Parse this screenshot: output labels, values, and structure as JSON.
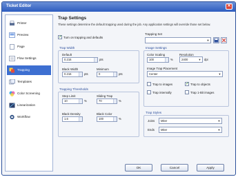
{
  "window": {
    "title": "Ticket Editor"
  },
  "sidebar": {
    "items": [
      {
        "label": "Printer",
        "icon": "printer-icon",
        "active": false
      },
      {
        "label": "Preview",
        "icon": "preview-icon",
        "active": false
      },
      {
        "label": "Page",
        "icon": "page-icon",
        "active": false
      },
      {
        "label": "Flow Settings",
        "icon": "flow-settings-icon",
        "active": false
      },
      {
        "label": "Trapping",
        "icon": "trapping-icon",
        "active": true
      },
      {
        "label": "Templates",
        "icon": "templates-icon",
        "active": false
      },
      {
        "label": "Color Screening",
        "icon": "color-screening-icon",
        "active": false
      },
      {
        "label": "Linearization",
        "icon": "linearization-icon",
        "active": false
      },
      {
        "label": "Workflow",
        "icon": "workflow-icon",
        "active": false
      }
    ]
  },
  "trap": {
    "title": "Trap Settings",
    "description": "These settings determine the default trapping used during the job. Any application settings will override those set below.",
    "turn_on_label": "Turn on trapping and defaults",
    "trapping_set_label": "Trapping Set",
    "trapping_set_value": "",
    "trap_width": {
      "title": "Trap Width",
      "default_label": "Default",
      "default_value": "0.216",
      "default_unit": "pts",
      "black_width_label": "Black Width",
      "black_width_value": "0.216",
      "black_width_unit": "pts",
      "minimum_label": "Minimum",
      "minimum_value": "0",
      "minimum_unit": "pts"
    },
    "thresholds": {
      "title": "Trapping Thresholds",
      "step_limit_label": "Step Limit",
      "step_limit_value": "10",
      "step_limit_unit": "%",
      "sliding_trap_label": "Sliding Trap",
      "sliding_trap_value": "70",
      "sliding_trap_unit": "%",
      "black_density_label": "Black Density",
      "black_density_value": "1.6",
      "black_color_label": "Black Color",
      "black_color_value": "100",
      "black_color_unit": "%"
    },
    "image_settings": {
      "title": "Image Settings",
      "color_scaling_label": "Color Scaling",
      "color_scaling_value": "100",
      "color_scaling_unit": "%",
      "resolution_label": "Resolution",
      "resolution_value": "2400",
      "resolution_unit": "dpi",
      "placement_label": "Image Trap Placement",
      "placement_value": "Center",
      "trap_to_images_label": "Trap to images",
      "trap_to_objects_label": "Trap to objects",
      "trap_internally_label": "Trap internally",
      "trap_1bit_label": "Trap 1-Bit images"
    },
    "trap_styles": {
      "title": "Trap Styles",
      "joins_label": "Joins",
      "joins_value": "Miter",
      "ends_label": "Ends",
      "ends_value": "Miter"
    }
  },
  "footer": {
    "ok": "OK",
    "cancel": "Cancel",
    "apply": "Apply"
  },
  "colors": {
    "accent": "#3d6fd1",
    "titlebar": "#2d5cc0",
    "close": "#d9463a"
  }
}
